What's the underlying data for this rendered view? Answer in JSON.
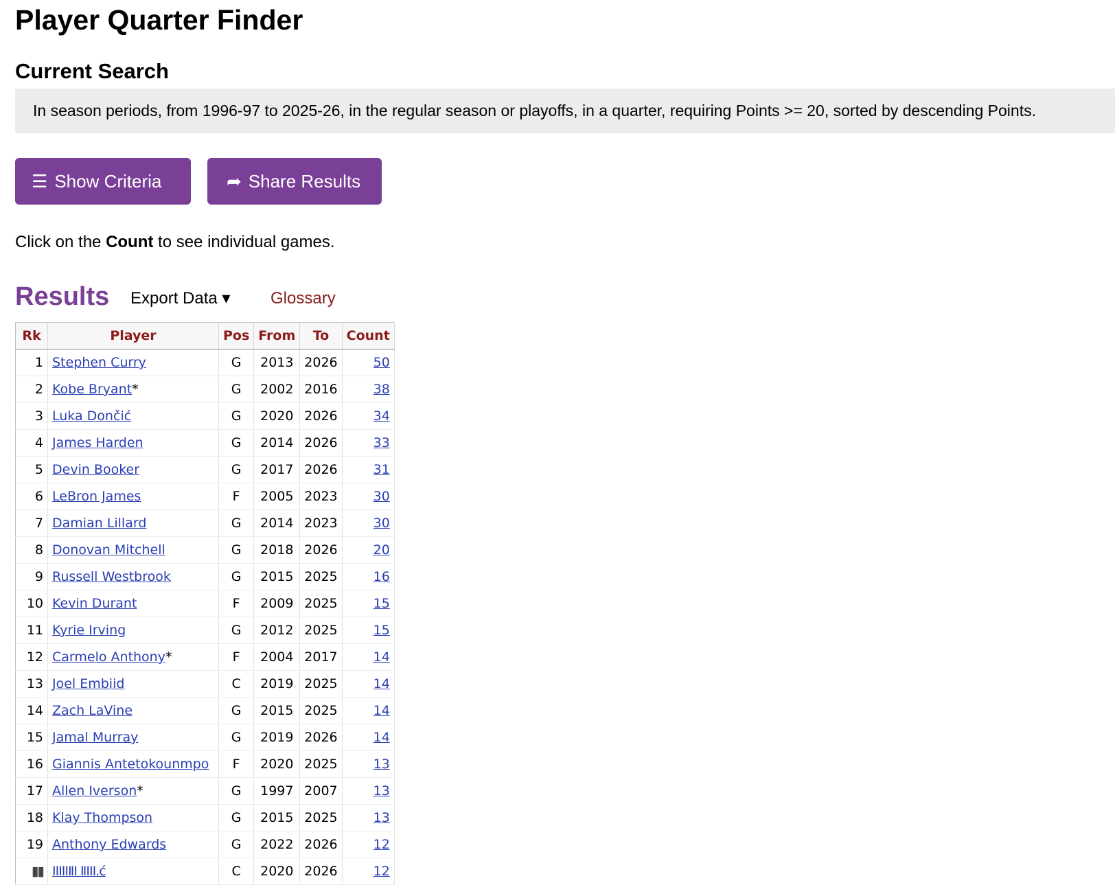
{
  "page_title": "Player Quarter Finder",
  "current_search": {
    "heading": "Current Search",
    "text": "In season periods, from 1996-97 to 2025-26, in the regular season or playoffs, in a quarter, requiring Points >= 20, sorted by descending Points."
  },
  "buttons": {
    "show_criteria": "Show Criteria",
    "share_results": "Share Results",
    "show_criteria_icon": "menu-icon",
    "share_results_icon": "share-arrow-icon"
  },
  "hint": {
    "prefix": "Click on the",
    "bold": "Count",
    "suffix": "to see individual games."
  },
  "results": {
    "title": "Results",
    "export_label": "Export Data ▾",
    "glossary_label": "Glossary"
  },
  "table": {
    "headers": [
      "Rk",
      "Player",
      "Pos",
      "From",
      "To",
      "Count"
    ],
    "rows": [
      {
        "rk": "1",
        "player": "Stephen Curry",
        "star": "",
        "pos": "G",
        "from": "2013",
        "to": "2026",
        "count": "50"
      },
      {
        "rk": "2",
        "player": "Kobe Bryant",
        "star": "*",
        "pos": "G",
        "from": "2002",
        "to": "2016",
        "count": "38"
      },
      {
        "rk": "3",
        "player": "Luka Dončić",
        "star": "",
        "pos": "G",
        "from": "2020",
        "to": "2026",
        "count": "34"
      },
      {
        "rk": "4",
        "player": "James Harden",
        "star": "",
        "pos": "G",
        "from": "2014",
        "to": "2026",
        "count": "33"
      },
      {
        "rk": "5",
        "player": "Devin Booker",
        "star": "",
        "pos": "G",
        "from": "2017",
        "to": "2026",
        "count": "31"
      },
      {
        "rk": "6",
        "player": "LeBron James",
        "star": "",
        "pos": "F",
        "from": "2005",
        "to": "2023",
        "count": "30"
      },
      {
        "rk": "7",
        "player": "Damian Lillard",
        "star": "",
        "pos": "G",
        "from": "2014",
        "to": "2023",
        "count": "30"
      },
      {
        "rk": "8",
        "player": "Donovan Mitchell",
        "star": "",
        "pos": "G",
        "from": "2018",
        "to": "2026",
        "count": "20"
      },
      {
        "rk": "9",
        "player": "Russell Westbrook",
        "star": "",
        "pos": "G",
        "from": "2015",
        "to": "2025",
        "count": "16"
      },
      {
        "rk": "10",
        "player": "Kevin Durant",
        "star": "",
        "pos": "F",
        "from": "2009",
        "to": "2025",
        "count": "15"
      },
      {
        "rk": "11",
        "player": "Kyrie Irving",
        "star": "",
        "pos": "G",
        "from": "2012",
        "to": "2025",
        "count": "15"
      },
      {
        "rk": "12",
        "player": "Carmelo Anthony",
        "star": "*",
        "pos": "F",
        "from": "2004",
        "to": "2017",
        "count": "14"
      },
      {
        "rk": "13",
        "player": "Joel Embiid",
        "star": "",
        "pos": "C",
        "from": "2019",
        "to": "2025",
        "count": "14"
      },
      {
        "rk": "14",
        "player": "Zach LaVine",
        "star": "",
        "pos": "G",
        "from": "2015",
        "to": "2025",
        "count": "14"
      },
      {
        "rk": "15",
        "player": "Jamal Murray",
        "star": "",
        "pos": "G",
        "from": "2019",
        "to": "2026",
        "count": "14"
      },
      {
        "rk": "16",
        "player": "Giannis Antetokounmpo",
        "star": "",
        "pos": "F",
        "from": "2020",
        "to": "2025",
        "count": "13"
      },
      {
        "rk": "17",
        "player": "Allen Iverson",
        "star": "*",
        "pos": "G",
        "from": "1997",
        "to": "2007",
        "count": "13"
      },
      {
        "rk": "18",
        "player": "Klay Thompson",
        "star": "",
        "pos": "G",
        "from": "2015",
        "to": "2025",
        "count": "13"
      },
      {
        "rk": "19",
        "player": "Anthony Edwards",
        "star": "",
        "pos": "G",
        "from": "2022",
        "to": "2026",
        "count": "12"
      },
      {
        "rk": "▮▮",
        "player": "ⅠⅠⅠⅠⅠⅡⅠ ⅡⅠⅠⅠ.ć",
        "star": "",
        "pos": "C",
        "from": "2020",
        "to": "2026",
        "count": "12",
        "obscured": true
      }
    ]
  },
  "colors": {
    "accent": "#7a3f96",
    "header_text": "#8b1a1a",
    "link": "#2a3fb3",
    "search_bg": "#ececec"
  }
}
